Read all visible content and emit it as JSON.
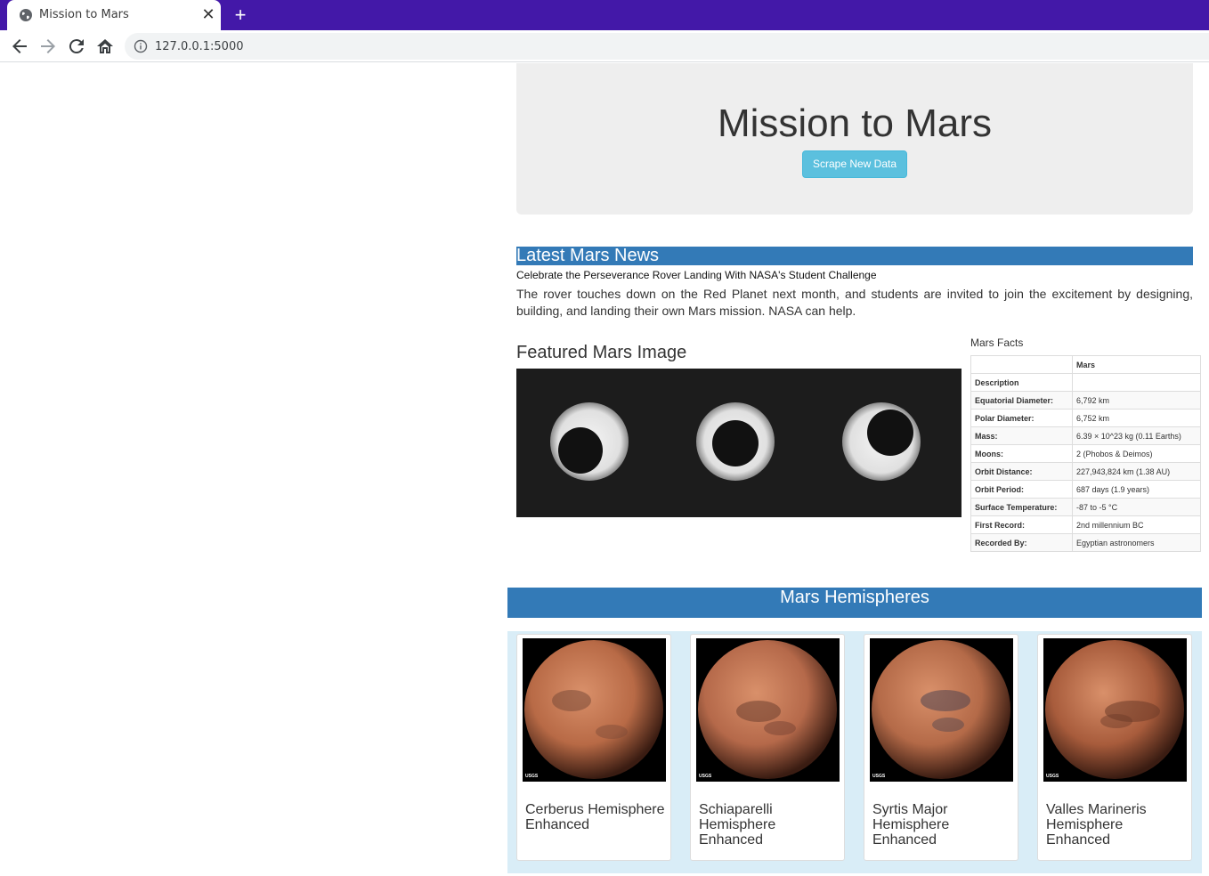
{
  "browser": {
    "tab_title": "Mission to Mars",
    "close_glyph": "✕",
    "newtab_glyph": "+",
    "url": "127.0.0.1:5000"
  },
  "jumbotron": {
    "title": "Mission to Mars",
    "button_label": "Scrape New Data"
  },
  "news": {
    "heading": "Latest Mars News",
    "title": "Celebrate the Perseverance Rover Landing With NASA's Student Challenge",
    "paragraph": "The rover touches down on the Red Planet next month, and students are invited to join the excitement by designing, building, and landing their own Mars mission. NASA can help."
  },
  "featured": {
    "heading": "Featured Mars Image"
  },
  "facts": {
    "caption": "Mars Facts",
    "header_label": "Mars",
    "rows": [
      {
        "k": "Description",
        "v": ""
      },
      {
        "k": "Equatorial Diameter:",
        "v": "6,792 km"
      },
      {
        "k": "Polar Diameter:",
        "v": "6,752 km"
      },
      {
        "k": "Mass:",
        "v": "6.39 × 10^23 kg (0.11 Earths)"
      },
      {
        "k": "Moons:",
        "v": "2 (Phobos & Deimos)"
      },
      {
        "k": "Orbit Distance:",
        "v": "227,943,824 km (1.38 AU)"
      },
      {
        "k": "Orbit Period:",
        "v": "687 days (1.9 years)"
      },
      {
        "k": "Surface Temperature:",
        "v": "-87 to -5 °C"
      },
      {
        "k": "First Record:",
        "v": "2nd millennium BC"
      },
      {
        "k": "Recorded By:",
        "v": "Egyptian astronomers"
      }
    ]
  },
  "hemispheres": {
    "heading": "Mars Hemispheres",
    "usgs_label": "USGS",
    "items": [
      {
        "title": "Cerberus Hemisphere Enhanced",
        "base": "#b86a46",
        "dark": "#7a4a38"
      },
      {
        "title": "Schiaparelli Hemisphere Enhanced",
        "base": "#b5694a",
        "dark": "#6e3f30"
      },
      {
        "title": "Syrtis Major Hemisphere Enhanced",
        "base": "#b46a48",
        "dark": "#4e4450"
      },
      {
        "title": "Valles Marineris Hemisphere Enhanced",
        "base": "#a85c3c",
        "dark": "#6b3a28"
      }
    ]
  }
}
